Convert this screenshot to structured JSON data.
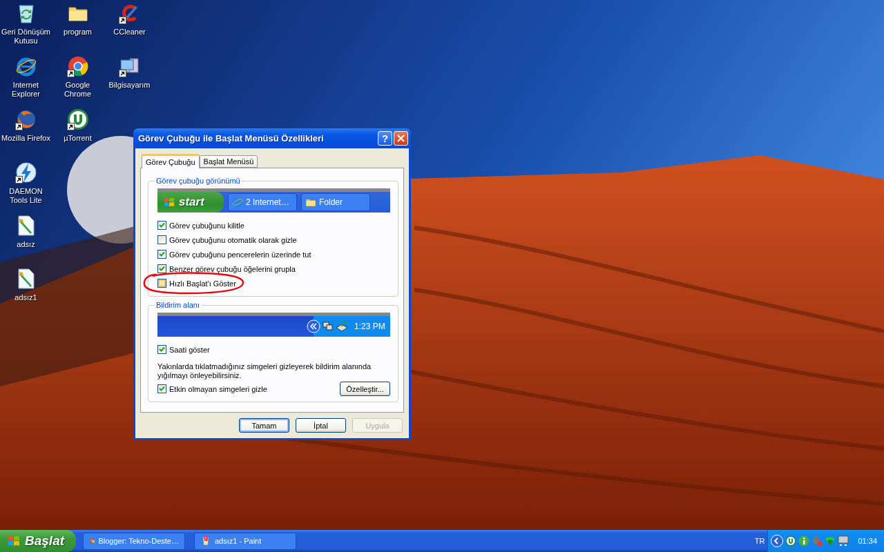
{
  "desktop": {
    "icon_columns": [
      {
        "icons": [
          {
            "label": "Geri Dönüşüm Kutusu",
            "kind": "recycle-bin",
            "shortcut": false
          },
          {
            "label": "Internet Explorer",
            "kind": "ie",
            "shortcut": false
          },
          {
            "label": "Mozilla Firefox",
            "kind": "firefox",
            "shortcut": true
          },
          {
            "label": "DAEMON Tools Lite",
            "kind": "daemon",
            "shortcut": true
          },
          {
            "label": "adsız",
            "kind": "paint-doc",
            "shortcut": false
          },
          {
            "label": "adsız1",
            "kind": "paint-doc",
            "shortcut": false
          }
        ]
      },
      {
        "icons": [
          {
            "label": "program",
            "kind": "folder",
            "shortcut": false
          },
          {
            "label": "Google Chrome",
            "kind": "chrome",
            "shortcut": true
          },
          {
            "label": "µTorrent",
            "kind": "utorrent",
            "shortcut": true
          }
        ]
      },
      {
        "icons": [
          {
            "label": "CCleaner",
            "kind": "ccleaner",
            "shortcut": true
          },
          {
            "label": "Bilgisayarım",
            "kind": "computer",
            "shortcut": true
          }
        ]
      }
    ]
  },
  "dialog": {
    "title": "Görev Çubuğu ile Başlat Menüsü Özellikleri",
    "help_button": "?",
    "tabs": [
      {
        "label": "Görev Çubuğu",
        "selected": true
      },
      {
        "label": "Başlat Menüsü",
        "selected": false
      }
    ],
    "appearance_group": {
      "title": "Görev çubuğu görünümü",
      "taskbar_preview": {
        "start": "start",
        "tasks": [
          {
            "label": "2 Internet…",
            "kind": "ie"
          },
          {
            "label": "Folder",
            "kind": "folder"
          }
        ]
      },
      "options": [
        {
          "label": "Görev çubuğunu kilitle",
          "checked": true,
          "hovered": false,
          "circled": false
        },
        {
          "label": "Görev çubuğunu otomatik olarak gizle",
          "checked": false,
          "hovered": false,
          "circled": false
        },
        {
          "label": "Görev çubuğunu pencerelerin üzerinde tut",
          "checked": true,
          "hovered": false,
          "circled": false
        },
        {
          "label": "Benzer görev çubuğu öğelerini grupla",
          "checked": true,
          "hovered": false,
          "circled": false
        },
        {
          "label": "Hızlı Başlat'ı Göster",
          "checked": false,
          "hovered": true,
          "circled": true
        }
      ]
    },
    "notification_group": {
      "title": "Bildirim alanı",
      "tray_preview": {
        "clock": "1:23 PM"
      },
      "items": [
        {
          "kind": "checkbox",
          "label": "Saati göster",
          "checked": true,
          "hovered": false
        },
        {
          "kind": "note",
          "text": "Yakınlarda tıklatmadığınız simgeleri gizleyerek bildirim alanında yığılmayı önleyebilirsiniz."
        },
        {
          "kind": "checkbox",
          "label": "Etkin olmayan simgeleri gizle",
          "checked": true,
          "hovered": false,
          "button": "Özelleştir..."
        }
      ]
    },
    "buttons": [
      {
        "label": "Tamam",
        "default": true,
        "disabled": false
      },
      {
        "label": "İptal",
        "default": false,
        "disabled": false
      },
      {
        "label": "Uygula",
        "default": false,
        "disabled": true
      }
    ]
  },
  "taskbar": {
    "start": "Başlat",
    "tasks": [
      {
        "label": "Blogger: Tekno-Deste…",
        "kind": "chrome"
      },
      {
        "label": "adsız1 - Paint",
        "kind": "paint"
      }
    ],
    "tray": {
      "language": "TR",
      "clock": "01:34"
    }
  }
}
